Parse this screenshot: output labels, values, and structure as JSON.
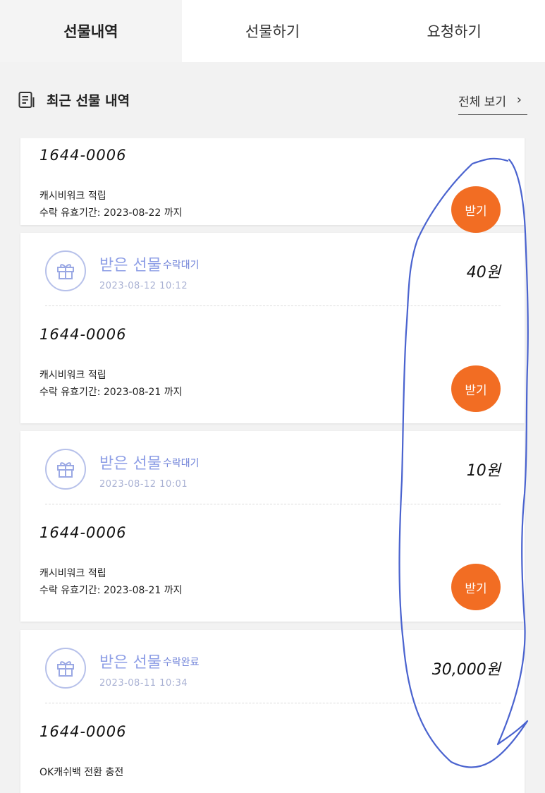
{
  "tabs": [
    {
      "label": "선물내역",
      "active": true
    },
    {
      "label": "선물하기",
      "active": false
    },
    {
      "label": "요청하기",
      "active": false
    }
  ],
  "section": {
    "title": "최근 선물 내역",
    "view_all": "전체 보기",
    "icon": "list-document-icon"
  },
  "cards": [
    {
      "phone": "1644-0006",
      "desc": "캐시비워크 적립",
      "validity": "수락 유효기간: 2023-08-22 까지",
      "button": "받기"
    },
    {
      "title": "받은 선물",
      "status": "수락대기",
      "date": "2023-08-12 10:12",
      "amount": "40원",
      "phone": "1644-0006",
      "desc": "캐시비워크 적립",
      "validity": "수락 유효기간: 2023-08-21 까지",
      "button": "받기"
    },
    {
      "title": "받은 선물",
      "status": "수락대기",
      "date": "2023-08-12 10:01",
      "amount": "10원",
      "phone": "1644-0006",
      "desc": "캐시비워크 적립",
      "validity": "수락 유효기간: 2023-08-21 까지",
      "button": "받기"
    },
    {
      "title": "받은 선물",
      "status": "수락완료",
      "date": "2023-08-11 10:34",
      "amount": "30,000원",
      "phone": "1644-0006",
      "desc": "OK캐쉬백 전환 충전"
    }
  ],
  "colors": {
    "accent": "#f26d23",
    "gift": "#8d9ee6",
    "scribble": "#4a63cf"
  }
}
